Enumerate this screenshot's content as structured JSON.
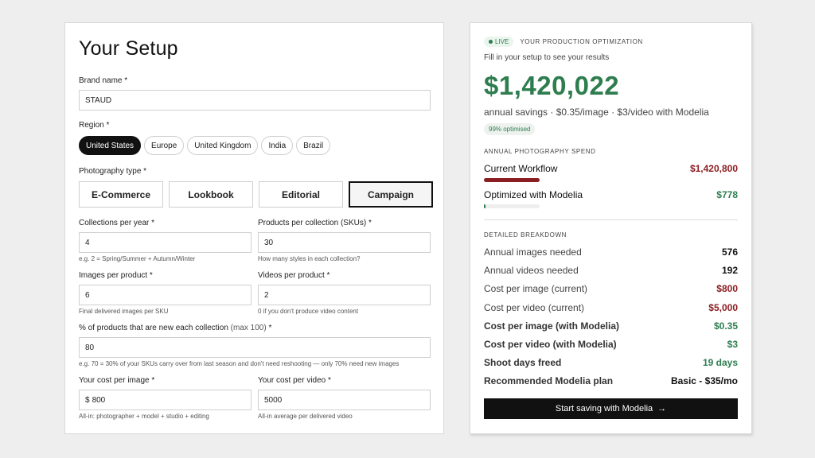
{
  "setup": {
    "title": "Your Setup",
    "brand_label": "Brand name *",
    "brand_value": "STAUD",
    "region_label": "Region *",
    "regions": [
      "United States",
      "Europe",
      "United Kingdom",
      "India",
      "Brazil"
    ],
    "region_selected": "United States",
    "phototype_label": "Photography type *",
    "phototypes": [
      "E-Commerce",
      "Lookbook",
      "Editorial",
      "Campaign"
    ],
    "phototype_selected": "Campaign",
    "collections_label": "Collections per year *",
    "collections_value": "4",
    "collections_hint": "e.g. 2 = Spring/Summer + Autumn/Winter",
    "products_label": "Products per collection (SKUs) *",
    "products_value": "30",
    "products_hint": "How many styles in each collection?",
    "images_label": "Images per product *",
    "images_value": "6",
    "images_hint": "Final delivered images per SKU",
    "videos_label": "Videos per product *",
    "videos_value": "2",
    "videos_hint": "0 if you don't produce video content",
    "newpct_label": "% of products that are new each collection",
    "newpct_label_max": "(max 100)",
    "newpct_label_req": "*",
    "newpct_value": "80",
    "newpct_hint": "e.g. 70 = 30% of your SKUs carry over from last season and don't need reshooting — only 70% need new images",
    "costimg_label": "Your cost per image *",
    "costimg_prefix": "$",
    "costimg_value": "800",
    "costimg_hint": "All-in: photographer + model + studio + editing",
    "costvid_label": "Your cost per video *",
    "costvid_value": "5000",
    "costvid_hint": "All-in average per delivered video"
  },
  "results": {
    "live_label": "LIVE",
    "eyebrow": "YOUR PRODUCTION OPTIMIZATION",
    "prompt": "Fill in your setup to see your results",
    "savings": "$1,420,022",
    "savings_sub": "annual savings · $0.35/image · $3/video with Modelia",
    "optimised_badge": "99% optimised",
    "spend_heading": "ANNUAL PHOTOGRAPHY SPEND",
    "current_label": "Current Workflow",
    "current_value": "$1,420,800",
    "current_fill": 0.22,
    "optimized_label": "Optimized with Modelia",
    "optimized_value": "$778",
    "optimized_fill": 0.01,
    "breakdown_heading": "DETAILED BREAKDOWN",
    "breakdown": [
      {
        "label": "Annual images needed",
        "value": "576",
        "tone": "dark",
        "bold": false
      },
      {
        "label": "Annual videos needed",
        "value": "192",
        "tone": "dark",
        "bold": false
      },
      {
        "label": "Cost per image (current)",
        "value": "$800",
        "tone": "red",
        "bold": false
      },
      {
        "label": "Cost per video (current)",
        "value": "$5,000",
        "tone": "red",
        "bold": false
      },
      {
        "label": "Cost per image (with Modelia)",
        "value": "$0.35",
        "tone": "green",
        "bold": true
      },
      {
        "label": "Cost per video (with Modelia)",
        "value": "$3",
        "tone": "green",
        "bold": true
      },
      {
        "label": "Shoot days freed",
        "value": "19 days",
        "tone": "green",
        "bold": true
      },
      {
        "label": "Recommended Modelia plan",
        "value": "Basic - $35/mo",
        "tone": "dark",
        "bold": true
      }
    ],
    "cta_label": "Start saving with Modelia",
    "cta_arrow": "→"
  },
  "colors": {
    "accent_green": "#2e7d4f",
    "accent_red": "#8b1e22",
    "primary_dark": "#111111"
  }
}
